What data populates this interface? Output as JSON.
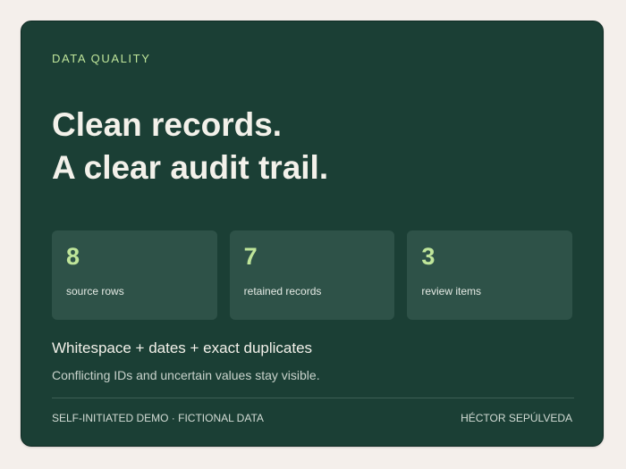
{
  "eyebrow": "DATA QUALITY",
  "headline": {
    "line1": "Clean records.",
    "line2": "A clear audit trail."
  },
  "stats": [
    {
      "value": "8",
      "label": "source rows"
    },
    {
      "value": "7",
      "label": "retained records"
    },
    {
      "value": "3",
      "label": "review items"
    }
  ],
  "summary": "Whitespace + dates + exact duplicates",
  "note": "Conflicting IDs and uncertain values stay visible.",
  "footer": {
    "left": "SELF-INITIATED DEMO · FICTIONAL DATA",
    "right": "HÉCTOR SEPÚLVEDA"
  },
  "colors": {
    "page_background": "#f4efeb",
    "card_background": "#1b3f35",
    "stat_background": "#2e5248",
    "accent": "#bfe59a",
    "text": "#f3f1ea"
  }
}
